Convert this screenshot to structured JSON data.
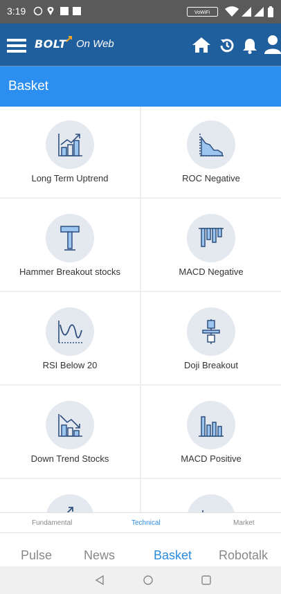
{
  "status_bar": {
    "time": "3:19",
    "wifi_badge": "VoWiFi"
  },
  "app_bar": {
    "logo_text": "BOLT",
    "logo_suffix": "On Web",
    "icons": [
      "menu-icon",
      "home-icon",
      "history-icon",
      "bell-icon",
      "user-icon"
    ]
  },
  "page": {
    "title": "Basket"
  },
  "grid": {
    "items": [
      {
        "label": "Long Term Uptrend",
        "icon": "uptrend-chart-icon"
      },
      {
        "label": "ROC Negative",
        "icon": "declining-area-chart-icon"
      },
      {
        "label": "Hammer Breakout stocks",
        "icon": "hammer-candle-icon"
      },
      {
        "label": "MACD Negative",
        "icon": "negative-histogram-icon"
      },
      {
        "label": "RSI Below 20",
        "icon": "rsi-wave-icon"
      },
      {
        "label": "Doji Breakout",
        "icon": "doji-candle-icon"
      },
      {
        "label": "Down Trend Stocks",
        "icon": "downtrend-chart-icon"
      },
      {
        "label": "MACD Positive",
        "icon": "positive-histogram-icon"
      },
      {
        "label": "",
        "icon": "partial-uptrend-icon"
      },
      {
        "label": "",
        "icon": "partial-chart-icon"
      }
    ]
  },
  "subtabs": [
    {
      "label": "Fundamental",
      "active": false
    },
    {
      "label": "Technical",
      "active": true
    },
    {
      "label": "Market",
      "active": false
    }
  ],
  "bottom_nav": [
    {
      "label": "Pulse",
      "active": false
    },
    {
      "label": "News",
      "active": false
    },
    {
      "label": "Basket",
      "active": true
    },
    {
      "label": "Robotalk",
      "active": false
    }
  ],
  "colors": {
    "status_bar": "#5a5a5a",
    "app_bar": "#1f5f9e",
    "page_header": "#2c8ff0",
    "accent": "#2a8ae0",
    "icon_circle": "#e4e8ef",
    "icon_stroke": "#2f4f7f",
    "icon_fill": "#9cc5f0"
  }
}
